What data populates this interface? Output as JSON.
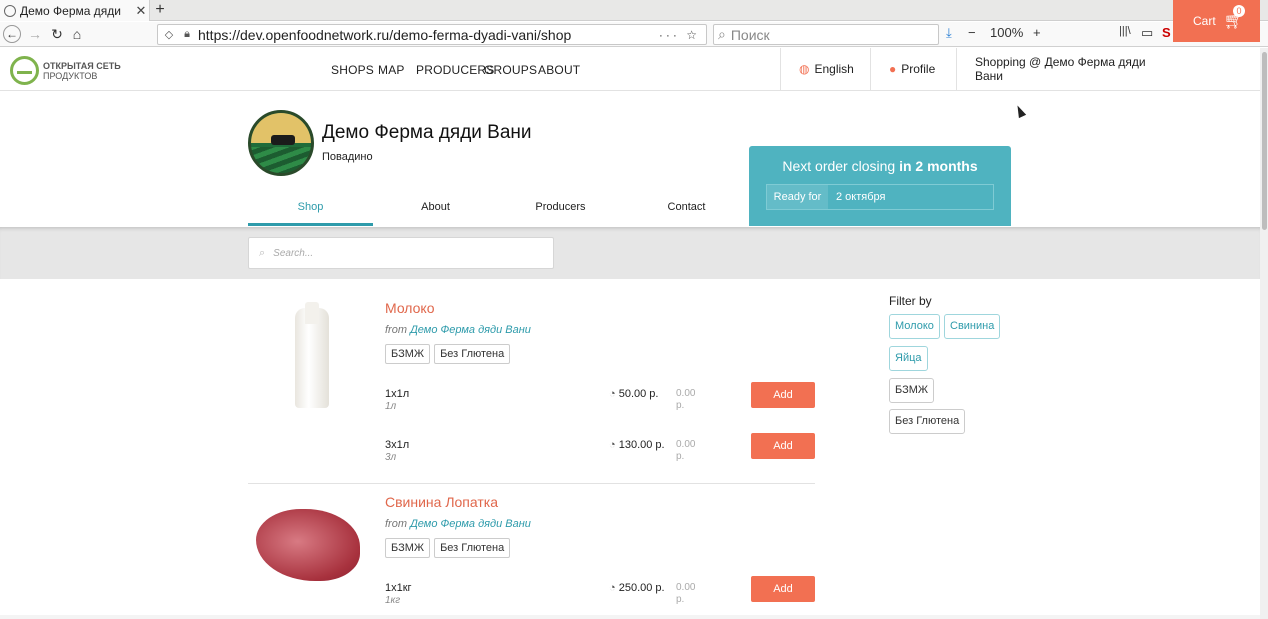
{
  "browser": {
    "tab_title": "Демо Ферма дяди",
    "url": "https://dev.openfoodnetwork.ru/demo-ferma-dyadi-vani/shop",
    "search_placeholder": "Поиск",
    "zoom": "100%"
  },
  "header": {
    "logo_line1": "ОТКРЫТАЯ СЕТЬ",
    "logo_line2": "ПРОДУКТОВ",
    "nav": [
      "SHOPS",
      "MAP",
      "PRODUCERS",
      "GROUPS",
      "ABOUT"
    ],
    "language": "English",
    "profile": "Profile",
    "shopping_at": "Shopping @ Демо Ферма дяди Вани",
    "cart_label": "Cart",
    "cart_count": "0"
  },
  "shop": {
    "name": "Демо Ферма дяди Вани",
    "city": "Повадино",
    "tabs": [
      "Shop",
      "About",
      "Producers",
      "Contact"
    ],
    "active_tab": "Shop",
    "order_closing_prefix": "Next order closing",
    "order_closing_time": "in 2 months",
    "ready_for_label": "Ready for",
    "ready_for_value": "2 октября"
  },
  "search": {
    "placeholder": "Search..."
  },
  "products": [
    {
      "name": "Молоко",
      "from_label": "from",
      "producer": "Демо Ферма дяди Вани",
      "tags": [
        "БЗМЖ",
        "Без Глютена"
      ],
      "variants": [
        {
          "name": "1x1л",
          "unit": "1л",
          "price": "50.00 р.",
          "total": "0.00 р.",
          "button": "Add"
        },
        {
          "name": "3x1л",
          "unit": "3л",
          "price": "130.00 р.",
          "total": "0.00 р.",
          "button": "Add"
        }
      ]
    },
    {
      "name": "Свинина Лопатка",
      "from_label": "from",
      "producer": "Демо Ферма дяди Вани",
      "tags": [
        "БЗМЖ",
        "Без Глютена"
      ],
      "variants": [
        {
          "name": "1x1кг",
          "unit": "1кг",
          "price": "250.00 р.",
          "total": "0.00 р.",
          "button": "Add"
        }
      ]
    }
  ],
  "filters": {
    "title": "Filter by",
    "categories": [
      "Молоко",
      "Свинина",
      "Яйца"
    ],
    "tags": [
      "БЗМЖ",
      "Без Глютена"
    ]
  },
  "colors": {
    "accent": "#f27052",
    "teal": "#2e9bab",
    "order_box": "#4fb3c0"
  }
}
